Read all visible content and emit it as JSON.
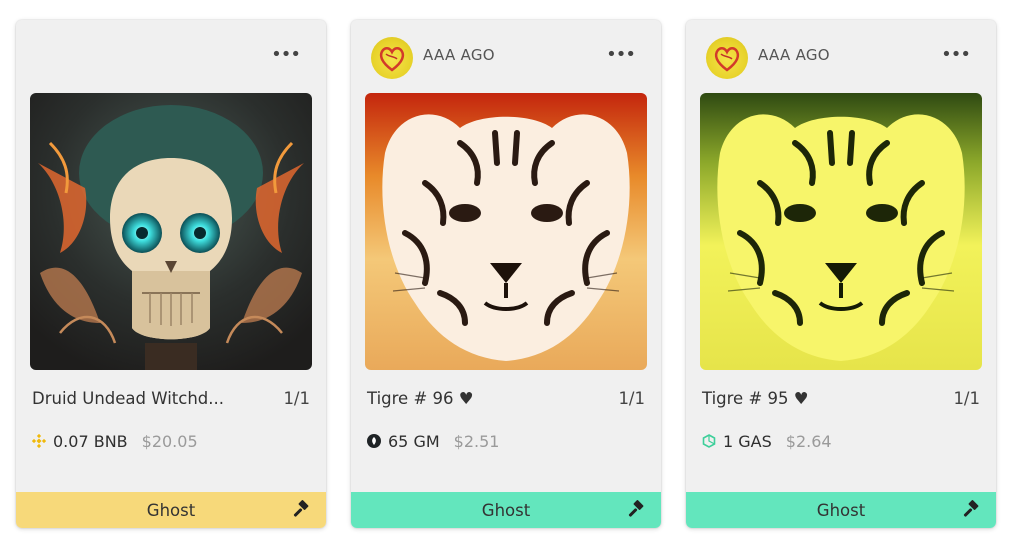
{
  "cards": [
    {
      "creator": "",
      "more_label": "•••",
      "name": "Druid Undead Witchd...",
      "edition": "1/1",
      "amount": "0.07 BNB",
      "usd": "$20.05",
      "footer_label": "Ghost",
      "coin_icon": "bnb-icon",
      "footer_color": "#f7d97a"
    },
    {
      "creator": "AAA AGO",
      "more_label": "•••",
      "name": "Tigre # 96 ♥",
      "edition": "1/1",
      "amount": "65 GM",
      "usd": "$2.51",
      "footer_label": "Ghost",
      "coin_icon": "gm-icon",
      "footer_color": "#63e6bd"
    },
    {
      "creator": "AAA AGO",
      "more_label": "•••",
      "name": "Tigre # 95 ♥",
      "edition": "1/1",
      "amount": "1 GAS",
      "usd": "$2.64",
      "footer_label": "Ghost",
      "coin_icon": "gas-icon",
      "footer_color": "#63e6bd"
    }
  ]
}
